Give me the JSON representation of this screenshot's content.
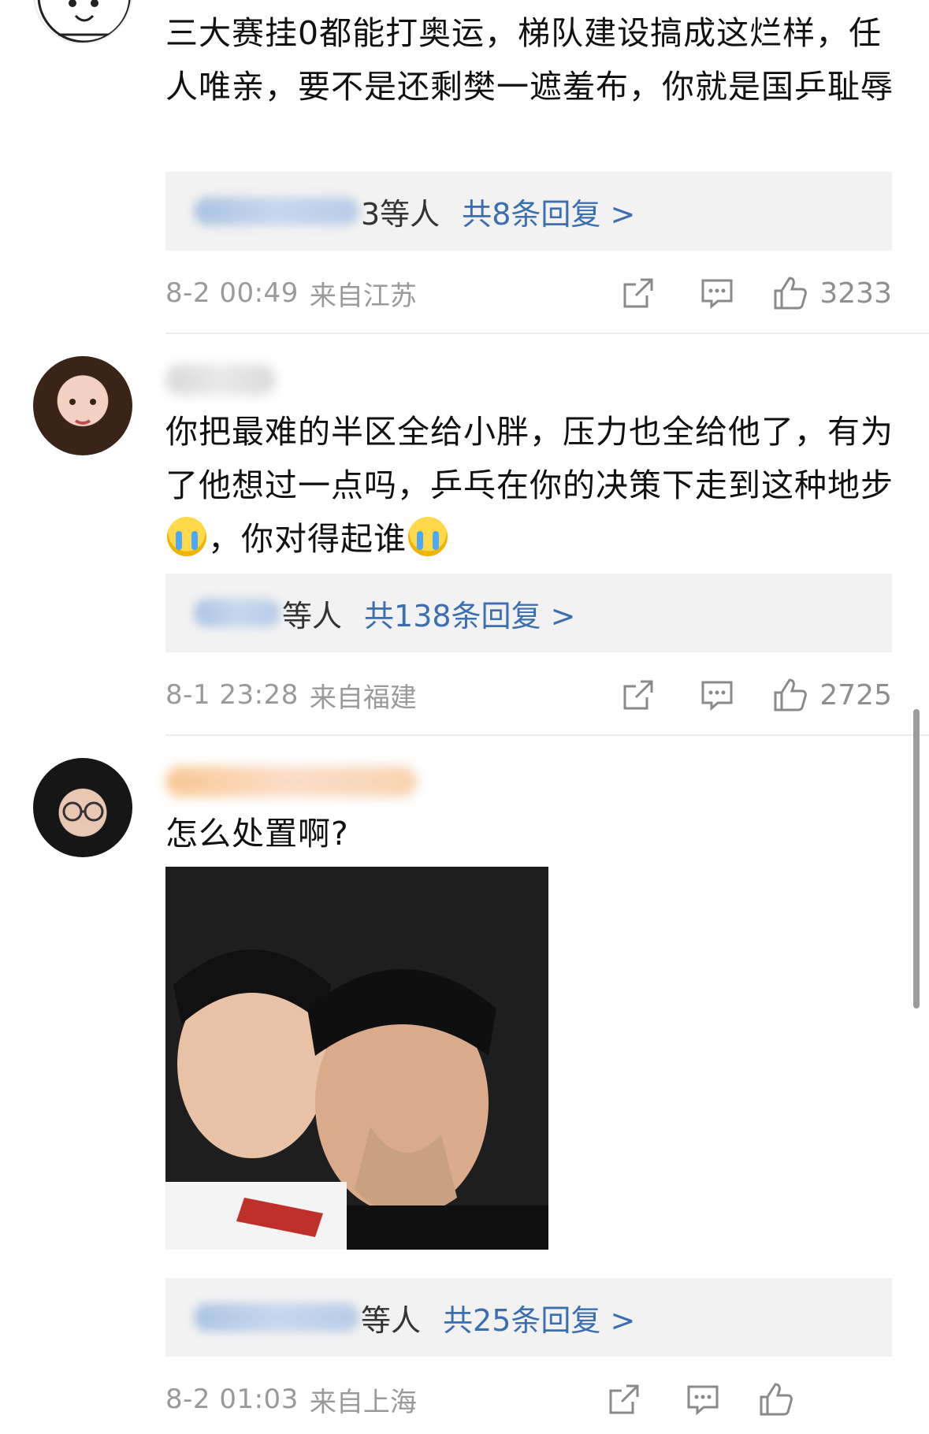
{
  "comments": [
    {
      "text": "三大赛挂0都能打奥运，梯队建设搞成这烂样，任人唯亲，要不是还剩樊一遮羞布，你就是国乒耻辱",
      "reply_suffix": "3等人",
      "reply_link": "共8条回复 >",
      "time": "8-2 00:49",
      "location": "来自江苏",
      "likes": "3233"
    },
    {
      "text_before_emoji_1": "你把最难的半区全给小胖，压力也全给他了，有为了他想过一点吗，乒乓在你的决策下走到这种地步",
      "text_between_emoji": "，你对得起谁",
      "emoji": "crying-face-emoji",
      "reply_suffix": "等人",
      "reply_link": "共138条回复 >",
      "time": "8-1 23:28",
      "location": "来自福建",
      "likes": "2725"
    },
    {
      "text": "怎么处置啊?",
      "reply_suffix": "等人",
      "reply_link": "共25条回复 >",
      "time": "8-2 01:03",
      "location": "来自上海"
    }
  ],
  "icons": {
    "share": "share-icon",
    "comment": "comment-icon",
    "like": "thumbs-up-icon"
  },
  "colors": {
    "link": "#3b6fb0",
    "meta": "#9a9a9a",
    "reply_bg": "#f2f2f2"
  }
}
